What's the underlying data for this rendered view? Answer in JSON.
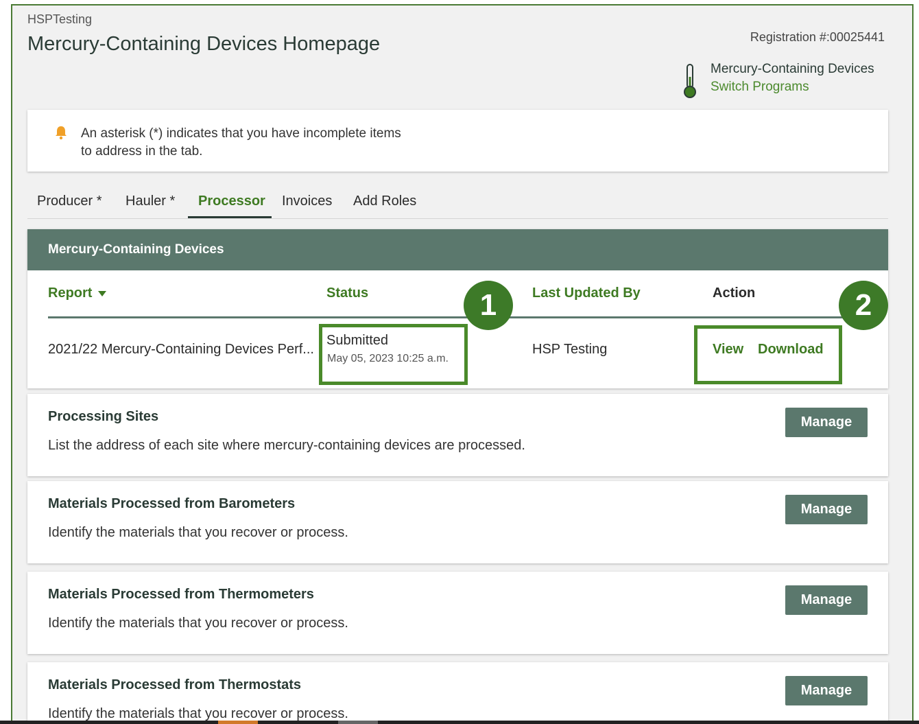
{
  "header": {
    "org": "HSPTesting",
    "title": "Mercury-Containing Devices Homepage",
    "registration": "Registration #:00025441",
    "program_name": "Mercury-Containing Devices",
    "switch_label": "Switch Programs",
    "program_icon": "thermometer-icon"
  },
  "notice": {
    "icon": "bell-icon",
    "text": "An asterisk (*) indicates that you have incomplete items to address in the tab."
  },
  "tabs": [
    {
      "label": "Producer *",
      "active": false
    },
    {
      "label": "Hauler *",
      "active": false
    },
    {
      "label": "Processor",
      "active": true
    },
    {
      "label": "Invoices",
      "active": false
    },
    {
      "label": "Add Roles",
      "active": false
    }
  ],
  "report_card": {
    "title": "Mercury-Containing Devices",
    "columns": [
      "Report",
      "Status",
      "Last Updated By",
      "Action"
    ],
    "row": {
      "report": "2021/22 Mercury-Containing Devices Perf...",
      "status": "Submitted",
      "status_date": "May 05, 2023 10:25 a.m.",
      "updated_by": "HSP Testing",
      "actions": [
        "View",
        "Download"
      ]
    }
  },
  "callouts": [
    "1",
    "2"
  ],
  "sections": [
    {
      "title": "Processing Sites",
      "desc": "List the address of each site where mercury-containing devices are processed.",
      "button": "Manage"
    },
    {
      "title": "Materials Processed from Barometers",
      "desc": "Identify the materials that you recover or process.",
      "button": "Manage"
    },
    {
      "title": "Materials Processed from Thermometers",
      "desc": "Identify the materials that you recover or process.",
      "button": "Manage"
    },
    {
      "title": "Materials Processed from Thermostats",
      "desc": "Identify the materials that you recover or process.",
      "button": "Manage"
    }
  ],
  "colors": {
    "accent_green": "#3e7a22",
    "header_teal": "#5b786d",
    "highlight_green": "#4a8a2a",
    "bell_orange": "#f0a028"
  }
}
